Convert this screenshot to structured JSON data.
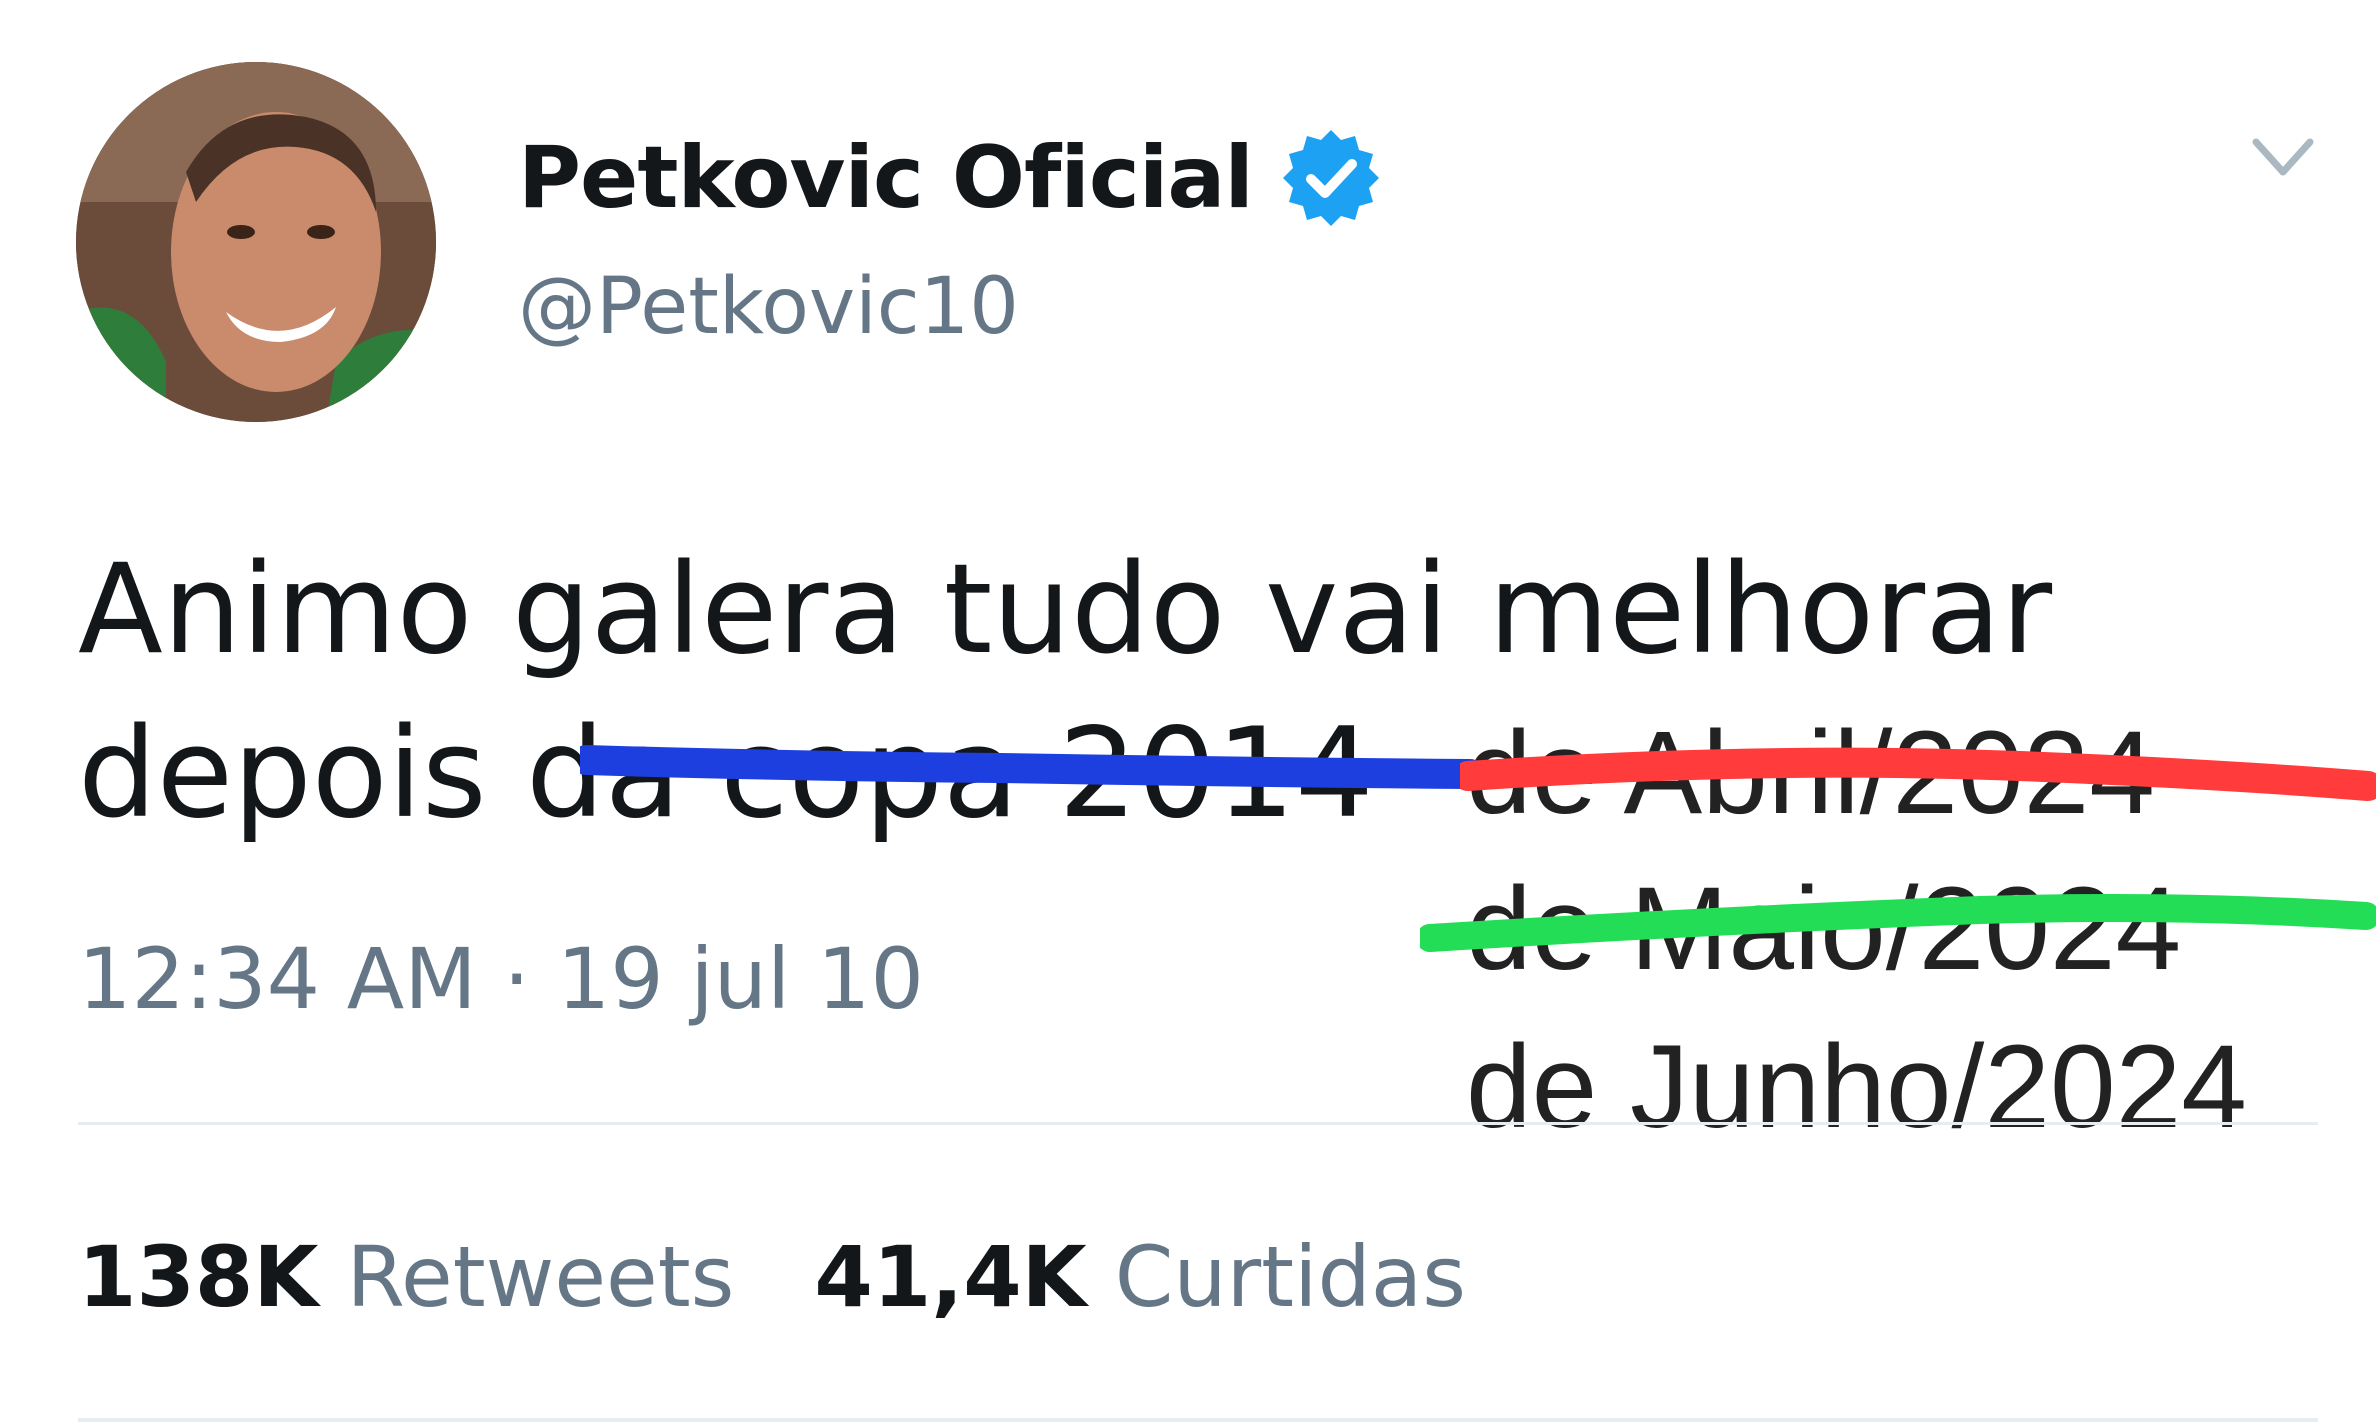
{
  "author": {
    "display_name": "Petkovic Oficial",
    "handle": "@Petkovic10",
    "verified": true
  },
  "tweet": {
    "line_1": "Animo galera tudo vai melhorar",
    "line_2": "depois da copa 2014",
    "timestamp": "12:34 AM · 19 jul 10"
  },
  "edits": [
    {
      "text": "de Abril/2024",
      "struck": true,
      "strike_color": "#ff3b3b"
    },
    {
      "text": "de Maio/2024",
      "struck": true,
      "strike_color": "#22dd55"
    },
    {
      "text": "de Junho/2024",
      "struck": false
    }
  ],
  "struck_original": {
    "text": "da copa 2014",
    "strike_color": "#1d3fe0"
  },
  "stats": {
    "retweets_count": "138K",
    "retweets_label": "Retweets",
    "likes_count": "41,4K",
    "likes_label": "Curtidas"
  },
  "colors": {
    "verified_badge": "#1da1f2",
    "secondary_text": "#657786",
    "primary_text": "#14171a"
  },
  "icons": {
    "verified": "verified-badge-icon",
    "menu": "chevron-down-icon"
  }
}
